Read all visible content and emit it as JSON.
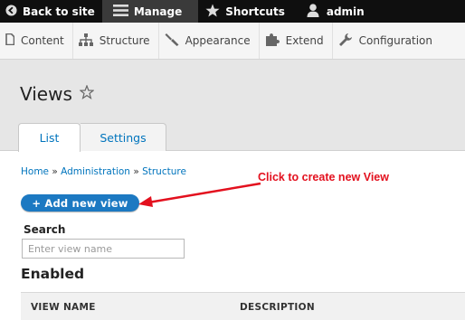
{
  "toolbar": {
    "back_label": "Back to site",
    "manage_label": "Manage",
    "shortcuts_label": "Shortcuts",
    "user_label": "admin"
  },
  "tray": {
    "items": [
      {
        "label": "Content",
        "icon": "content-icon"
      },
      {
        "label": "Structure",
        "icon": "structure-icon"
      },
      {
        "label": "Appearance",
        "icon": "appearance-icon"
      },
      {
        "label": "Extend",
        "icon": "extend-icon"
      },
      {
        "label": "Configuration",
        "icon": "configuration-icon"
      }
    ]
  },
  "page": {
    "title": "Views",
    "tabs": [
      {
        "label": "List",
        "active": true
      },
      {
        "label": "Settings",
        "active": false
      }
    ],
    "breadcrumb": [
      "Home",
      "Administration",
      "Structure"
    ],
    "breadcrumb_separator": "»"
  },
  "actions": {
    "add_view_label": "+ Add new view"
  },
  "annotation": {
    "text": "Click to create new View",
    "color": "#e3101e"
  },
  "search": {
    "label": "Search",
    "placeholder": "Enter view name",
    "value": ""
  },
  "enabled": {
    "heading": "Enabled",
    "columns": [
      "VIEW NAME",
      "DESCRIPTION"
    ]
  },
  "colors": {
    "accent": "#0074bd",
    "button": "#1c79c2",
    "toolbar": "#0f0f0f"
  }
}
